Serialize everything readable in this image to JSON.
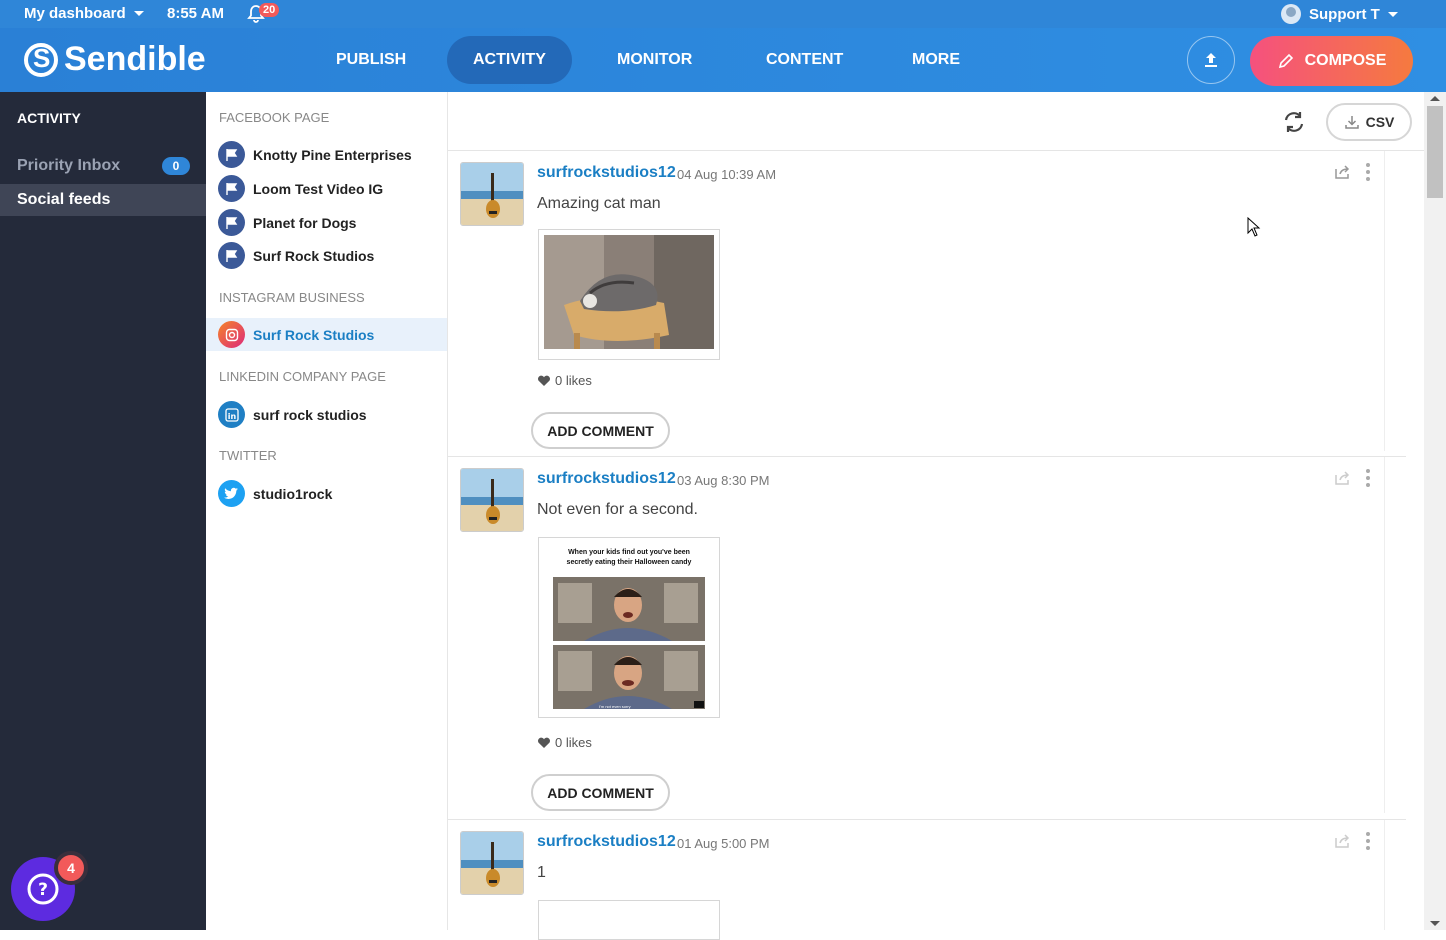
{
  "topbar": {
    "dashboard_label": "My dashboard",
    "time": "8:55 AM",
    "notifications_count": "20",
    "user_name": "Support T"
  },
  "nav": {
    "brand": "Sendible",
    "items": [
      "PUBLISH",
      "ACTIVITY",
      "MONITOR",
      "CONTENT",
      "MORE"
    ],
    "active": "ACTIVITY",
    "compose_label": "COMPOSE"
  },
  "sidebar": {
    "heading": "ACTIVITY",
    "items": [
      {
        "label": "Priority Inbox",
        "badge": "0"
      },
      {
        "label": "Social feeds"
      }
    ],
    "help_badge": "4"
  },
  "accounts": {
    "groups": [
      {
        "title": "FACEBOOK PAGE",
        "items": [
          "Knotty Pine Enterprises",
          "Loom Test Video IG",
          "Planet for Dogs",
          "Surf Rock Studios"
        ]
      },
      {
        "title": "INSTAGRAM BUSINESS",
        "items": [
          "Surf Rock Studios"
        ]
      },
      {
        "title": "LINKEDIN COMPANY PAGE",
        "items": [
          "surf rock studios"
        ]
      },
      {
        "title": "TWITTER",
        "items": [
          "studio1rock"
        ]
      }
    ]
  },
  "feed": {
    "csv_label": "CSV",
    "posts": [
      {
        "user": "surfrockstudios12",
        "date": "04 Aug 10:39 AM",
        "text": "Amazing cat man",
        "likes": "0 likes",
        "comment_label": "ADD COMMENT"
      },
      {
        "user": "surfrockstudios12",
        "date": "03 Aug 8:30 PM",
        "text": "Not even for a second.",
        "meme_caption": "When your kids find out you've been secretly eating their Halloween candy",
        "meme_subtitle": "I'm not even sorry",
        "likes": "0 likes",
        "comment_label": "ADD COMMENT"
      },
      {
        "user": "surfrockstudios12",
        "date": "01 Aug 5:00 PM",
        "text": "1"
      }
    ]
  },
  "colors": {
    "brand_blue": "#2f86d8",
    "sidebar_dark": "#242a3a",
    "compose_pink": "#f5517e",
    "link_blue": "#1b7fc4"
  }
}
